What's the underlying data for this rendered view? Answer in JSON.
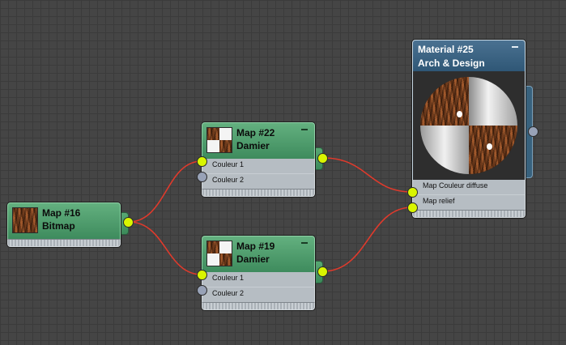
{
  "nodes": {
    "map16": {
      "name": "Map #16",
      "type": "Bitmap"
    },
    "map22": {
      "name": "Map #22",
      "type": "Damier",
      "slots": [
        "Couleur 1",
        "Couleur 2"
      ]
    },
    "map19": {
      "name": "Map #19",
      "type": "Damier",
      "slots": [
        "Couleur 1",
        "Couleur 2"
      ]
    },
    "material25": {
      "name": "Material #25",
      "type": "Arch & Design",
      "slots": [
        "Map Couleur diffuse",
        "Map relief"
      ]
    }
  },
  "colors": {
    "background": "#454545",
    "grid": "#3b3b3b",
    "map_header": "#4f9e6d",
    "material_header": "#3a6383",
    "port_connected": "#d9f500",
    "port_empty": "#98a2b7",
    "wire": "#e03a2c"
  }
}
